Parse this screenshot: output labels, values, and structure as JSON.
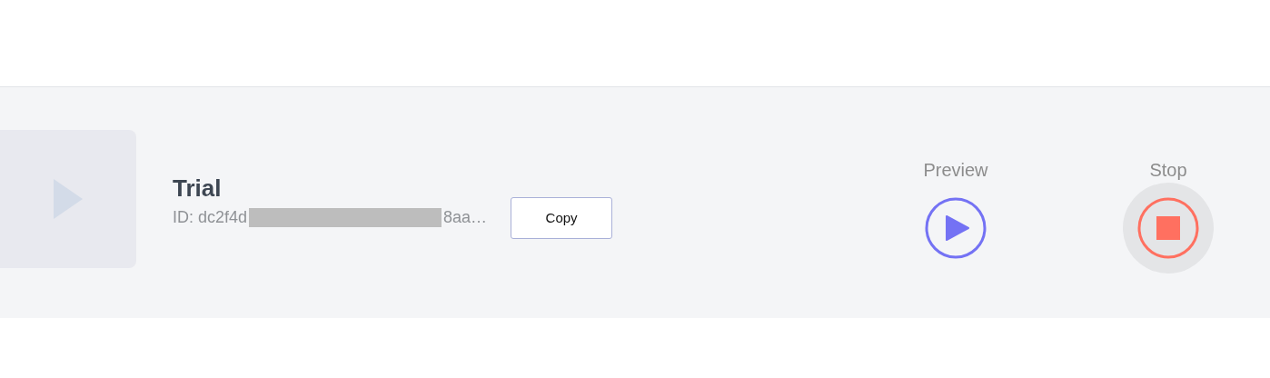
{
  "item": {
    "kind": "picture",
    "title": "Trial",
    "id_prefix": "ID: dc2f4d",
    "id_suffix": "8aa…",
    "copy_button": "Copy"
  },
  "actions": [
    {
      "kind": "play",
      "label": "Preview",
      "highlighted": false
    },
    {
      "kind": "stop",
      "label": "Stop",
      "highlighted": true
    }
  ]
}
